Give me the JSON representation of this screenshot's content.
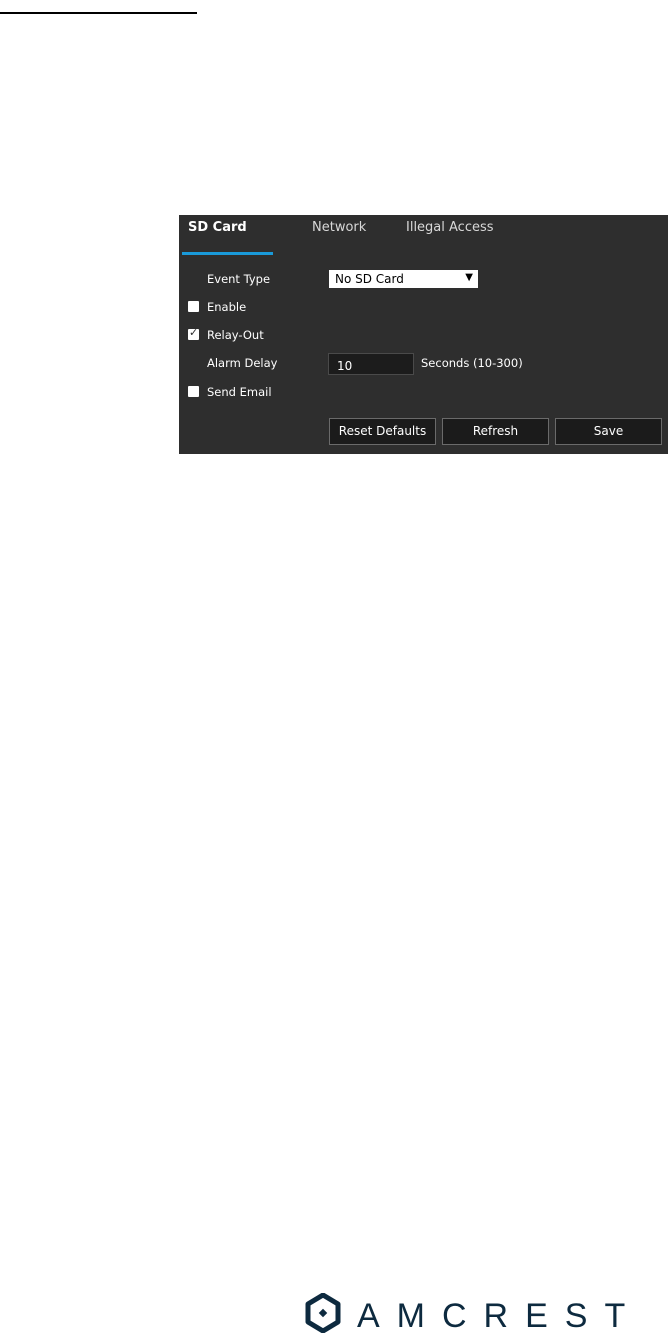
{
  "tabs": [
    {
      "label": "SD Card",
      "active": true
    },
    {
      "label": "Network",
      "active": false
    },
    {
      "label": "Illegal Access",
      "active": false
    }
  ],
  "form": {
    "event_type": {
      "label": "Event Type",
      "value": "No SD Card"
    },
    "enable": {
      "label": "Enable",
      "checked": false
    },
    "relay_out": {
      "label": "Relay-Out",
      "checked": true
    },
    "alarm_delay": {
      "label": "Alarm Delay",
      "value": "10",
      "hint": "Seconds (10-300)"
    },
    "send_email": {
      "label": "Send Email",
      "checked": false
    }
  },
  "buttons": {
    "reset_defaults": "Reset Defaults",
    "refresh": "Refresh",
    "save": "Save"
  },
  "brand": {
    "name": "AMCREST",
    "color": "#0d2a3f",
    "accent": "#1a9ad9"
  }
}
